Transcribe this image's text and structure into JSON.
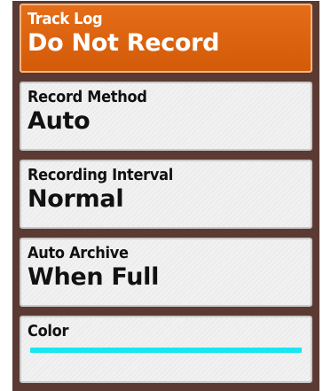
{
  "settings": [
    {
      "label": "Track Log",
      "value": "Do Not Record"
    },
    {
      "label": "Record Method",
      "value": "Auto"
    },
    {
      "label": "Recording Interval",
      "value": "Normal"
    },
    {
      "label": "Auto Archive",
      "value": "When Full"
    },
    {
      "label": "Color",
      "value": "",
      "swatch_color": "#19e6ef"
    }
  ],
  "colors": {
    "selected_background": "#e06512",
    "item_background": "#f1f1f1",
    "frame_background": "#5a3a32"
  }
}
